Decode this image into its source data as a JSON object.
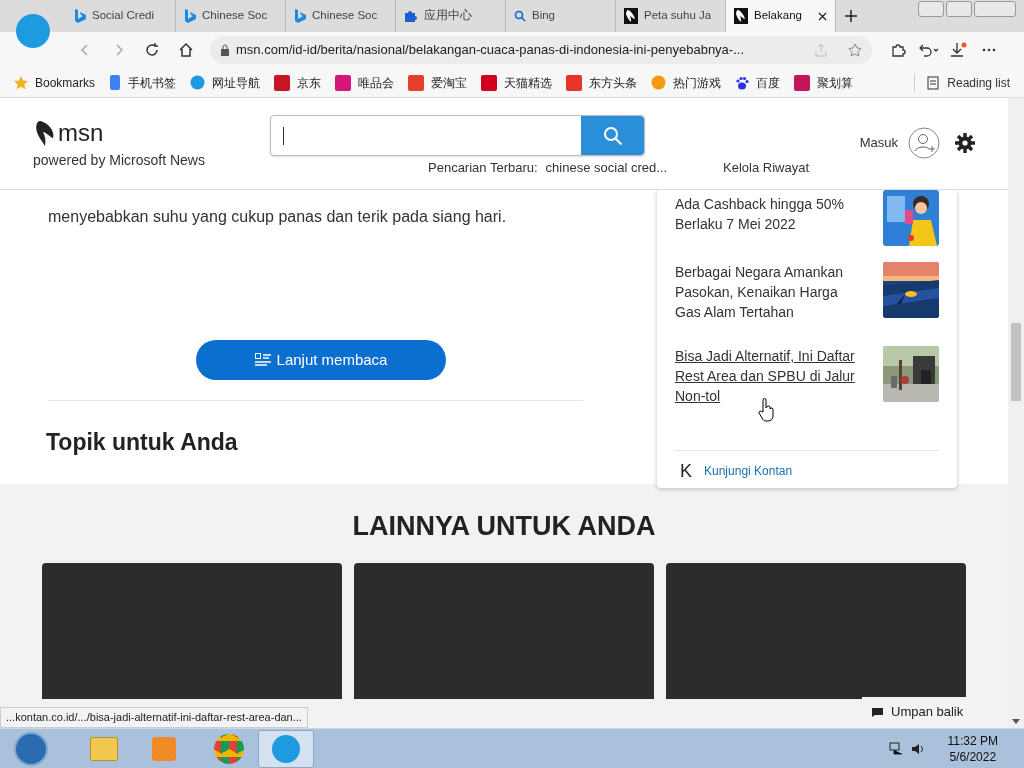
{
  "tabs": [
    {
      "title": "Social Credi",
      "kind": "bing",
      "selected": false
    },
    {
      "title": "Chinese Soc",
      "kind": "bing",
      "selected": false
    },
    {
      "title": "Chinese Soc",
      "kind": "bing",
      "selected": false
    },
    {
      "title": "应用中心",
      "kind": "puzzle",
      "selected": false
    },
    {
      "title": "Bing",
      "kind": "search",
      "selected": false
    },
    {
      "title": "Peta suhu Ja",
      "kind": "msn",
      "selected": false
    },
    {
      "title": "Belakang",
      "kind": "msn",
      "selected": true
    }
  ],
  "address": "msn.com/id-id/berita/nasional/belakangan-cuaca-panas-di-indonesia-ini-penyebabnya-...",
  "bookmarks": [
    {
      "label": "Bookmarks",
      "kind": "star",
      "color": "#f2b01e"
    },
    {
      "label": "手机书签",
      "kind": "phone",
      "color": "#3b82f6"
    },
    {
      "label": "网址导航",
      "kind": "edge",
      "color": "#1e9be0"
    },
    {
      "label": "京东",
      "kind": "square",
      "color": "#c81623"
    },
    {
      "label": "唯品会",
      "kind": "square",
      "color": "#d6157a"
    },
    {
      "label": "爱淘宝",
      "kind": "square",
      "color": "#e2402b"
    },
    {
      "label": "天猫精选",
      "kind": "square",
      "color": "#d0021b"
    },
    {
      "label": "东方头条",
      "kind": "square",
      "color": "#e8332a"
    },
    {
      "label": "热门游戏",
      "kind": "circle",
      "color": "#f39c12"
    },
    {
      "label": "百度",
      "kind": "paw",
      "color": "#2932e1"
    },
    {
      "label": "聚划算",
      "kind": "square",
      "color": "#c2185b"
    }
  ],
  "reading_list": "Reading list",
  "header": {
    "logo": "msn",
    "tagline": "powered by Microsoft News",
    "recent_label": "Pencarian Terbaru:",
    "recent_query": "chinese social cred...",
    "manage_history": "Kelola Riwayat",
    "sign_in": "Masuk"
  },
  "article": {
    "paragraph": "menyebabkan suhu yang cukup panas dan terik pada siang hari.",
    "continue_button": "Lanjut membaca",
    "topics_heading": "Topik untuk Anda"
  },
  "side_card": {
    "items": [
      {
        "title": "Ada Cashback hingga 50% Berlaku 7 Mei 2022",
        "hovered": false
      },
      {
        "title": "Berbagai Negara Amankan Pasokan, Kenaikan Harga Gas Alam Tertahan",
        "hovered": false
      },
      {
        "title": "Bisa Jadi Alternatif, Ini Daftar Rest Area dan SPBU di Jalur Non-tol",
        "hovered": true
      }
    ],
    "footer_logo": "K",
    "footer_link": "Kunjungi Kontan"
  },
  "more": {
    "heading": "LAINNYA UNTUK ANDA"
  },
  "status_url": "...kontan.co.id/.../bisa-jadi-alternatif-ini-daftar-rest-area-dan...",
  "feedback": "Umpan balik",
  "clock": {
    "time": "11:32 PM",
    "date": "5/6/2022"
  }
}
